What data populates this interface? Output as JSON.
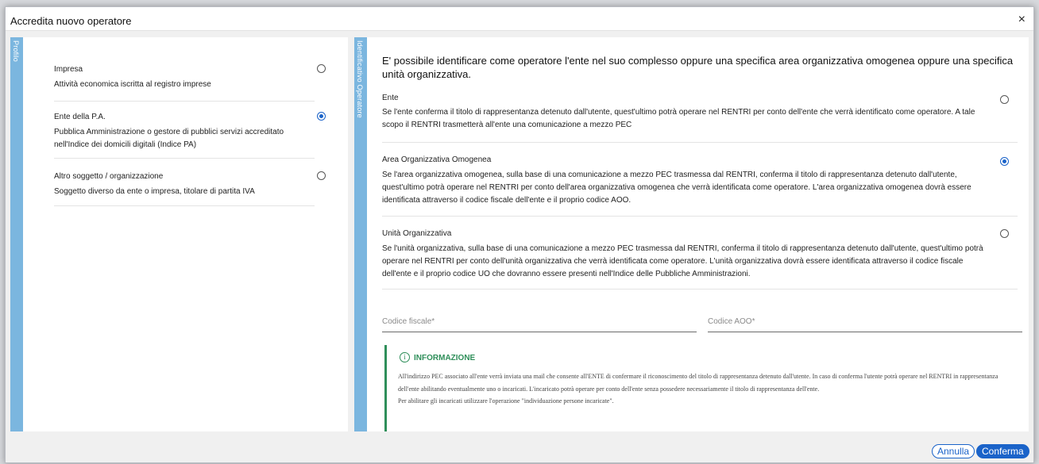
{
  "modal": {
    "title": "Accredita nuovo operatore",
    "close_glyph": "×"
  },
  "profile": {
    "tab_label": "Profilo",
    "options": [
      {
        "title": "Impresa",
        "desc": "Attività economica iscritta al registro imprese",
        "selected": false
      },
      {
        "title": "Ente della P.A.",
        "desc": "Pubblica Amministrazione o gestore di pubblici servizi accreditato nell'Indice dei domicili digitali (Indice PA)",
        "selected": true
      },
      {
        "title": "Altro soggetto / organizzazione",
        "desc": "Soggetto diverso da ente o impresa, titolare di partita IVA",
        "selected": false
      }
    ]
  },
  "identificativo": {
    "tab_label": "Identificativo Operatore",
    "heading": "E' possibile identificare come operatore l'ente nel suo complesso oppure una specifica area organizzativa omogenea oppure una specifica unità organizzativa.",
    "options": [
      {
        "title": "Ente",
        "desc": "Se l'ente conferma il titolo di rappresentanza detenuto dall'utente, quest'ultimo potrà operare nel RENTRI per conto dell'ente che verrà identificato come operatore. A tale scopo il RENTRI trasmetterà all'ente una comunicazione a mezzo PEC",
        "selected": false
      },
      {
        "title": "Area Organizzativa Omogenea",
        "desc": "Se l'area organizzativa omogenea, sulla base di una comunicazione a mezzo PEC trasmessa dal RENTRI, conferma il titolo di rappresentanza detenuto dall'utente, quest'ultimo potrà operare nel RENTRI per conto dell'area organizzativa omogenea che verrà identificata come operatore. L'area organizzativa omogenea dovrà essere identificata attraverso il codice fiscale dell'ente e il proprio codice AOO.",
        "selected": true
      },
      {
        "title": "Unità Organizzativa",
        "desc": "Se l'unità organizzativa, sulla base di una comunicazione a mezzo PEC trasmessa dal RENTRI, conferma il titolo di rappresentanza detenuto dall'utente, quest'ultimo potrà operare nel RENTRI per conto dell'unità organizzativa che verrà identificata come operatore. L'unità organizzativa dovrà essere identificata attraverso il codice fiscale dell'ente e il proprio codice UO che dovranno essere presenti nell'Indice delle Pubbliche Amministrazioni.",
        "selected": false
      }
    ],
    "fields": {
      "codice_fiscale_placeholder": "Codice fiscale*",
      "codice_fiscale_value": "",
      "codice_aoo_placeholder": "Codice AOO*",
      "codice_aoo_value": ""
    },
    "info": {
      "icon": "i",
      "title": "INFORMAZIONE",
      "paragraph1": "All'indirizzo PEC associato all'ente verrà inviata una mail che consente all'ENTE di confermare il riconoscimento del titolo di rappresentanza detenuto dall'utente. In caso di conferma l'utente potrà operare nel RENTRI in rappresentanza dell'ente abilitando eventualmente uno o incaricati. L'incaricato potrà operare per conto dell'ente senza possedere necessariamente il titolo di rappresentanza dell'ente.",
      "paragraph2": "Per abilitare gli incaricati utilizzare l'operazione \"individuazione persone incaricate\"."
    }
  },
  "footer": {
    "cancel_label": "Annulla",
    "confirm_label": "Conferma"
  },
  "colors": {
    "accent": "#1a63c9",
    "tab": "#7bb6df",
    "info": "#2f8f5a"
  }
}
